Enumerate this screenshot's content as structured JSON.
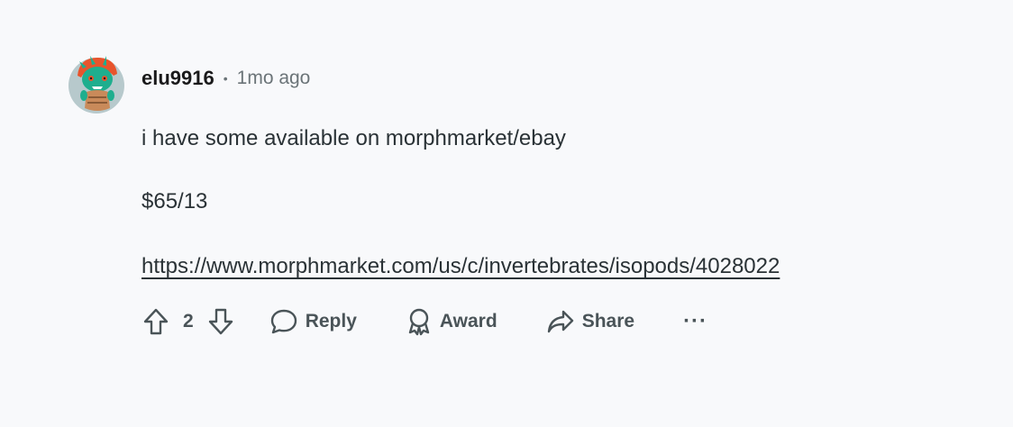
{
  "comment": {
    "username": "elu9916",
    "separator": "•",
    "timestamp": "1mo ago",
    "paragraphs": [
      "i have some available on morphmarket/ebay",
      "$65/13"
    ],
    "link_text": "https://www.morphmarket.com/us/c/invertebrates/isopods/4028022"
  },
  "actions": {
    "vote_count": "2",
    "reply_label": "Reply",
    "award_label": "Award",
    "share_label": "Share",
    "more_label": "···"
  },
  "icons": {
    "upvote": "upvote-icon",
    "downvote": "downvote-icon",
    "reply": "reply-icon",
    "award": "award-icon",
    "share": "share-icon",
    "more": "more-icon"
  },
  "colors": {
    "background": "#f8f9fb",
    "text": "#1a1a1b",
    "muted": "#6b7478",
    "action": "#4a5458",
    "avatar_bg": "#b7c9cc",
    "avatar_green": "#1fae8e",
    "avatar_orange": "#e8542c"
  }
}
